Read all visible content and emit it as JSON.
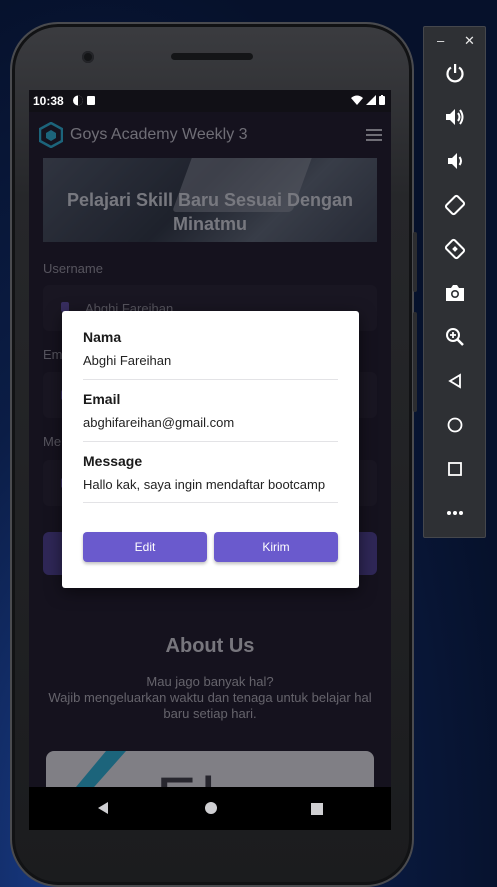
{
  "statusbar": {
    "time": "10:38"
  },
  "app": {
    "title": "Goys Academy Weekly 3"
  },
  "hero": {
    "text_line1": "Pelajari Skill Baru Sesuai Dengan",
    "text_line2": "Minatmu"
  },
  "form": {
    "username_label": "Username",
    "username_value": "Abghi Fareihan",
    "email_label_partial": "Em",
    "message_label_partial": "Me"
  },
  "about": {
    "title": "About Us",
    "line1": "Mau jago banyak hal?",
    "line2": "Wajib mengeluarkan waktu dan tenaga untuk belajar hal",
    "line3": "baru setiap hari."
  },
  "dialog": {
    "nama_label": "Nama",
    "nama_value": "Abghi Fareihan",
    "email_label": "Email",
    "email_value": "abghifareihan@gmail.com",
    "message_label": "Message",
    "message_value": "Hallo kak, saya ingin mendaftar bootcamp",
    "edit_label": "Edit",
    "kirim_label": "Kirim"
  },
  "colors": {
    "accent": "#6a5acd",
    "screen_bg": "#1e1b28",
    "logo": "#2aa7c9"
  },
  "toolbar": {
    "minimize": "–",
    "close": "✕",
    "icons": [
      "power-icon",
      "volume-up-icon",
      "volume-down-icon",
      "rotate-left-icon",
      "rotate-right-icon",
      "camera-icon",
      "zoom-icon",
      "back-icon",
      "home-icon",
      "overview-icon",
      "more-icon"
    ]
  }
}
